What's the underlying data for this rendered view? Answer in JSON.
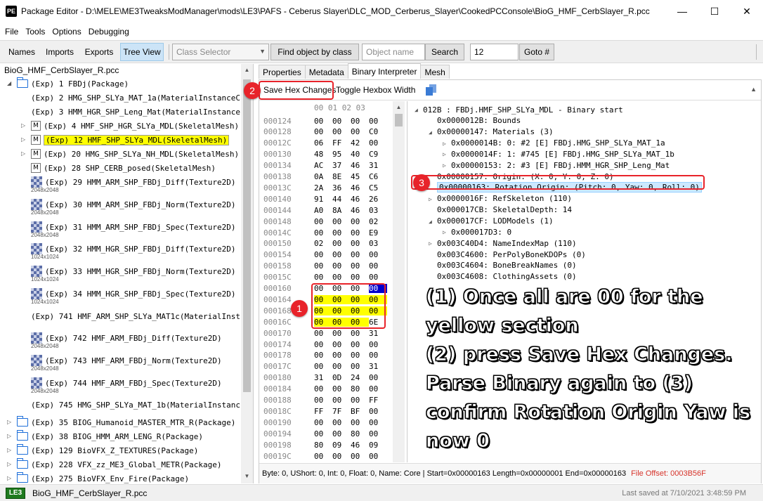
{
  "titlebar": {
    "icon_text": "PE",
    "title": "Package Editor - D:\\MELE\\ME3TweaksModManager\\mods\\LE3\\PAFS - Ceberus Slayer\\DLC_MOD_Cerberus_Slayer\\CookedPCConsole\\BioG_HMF_CerbSlayer_R.pcc",
    "minimize": "—",
    "maximize": "☐",
    "close": "✕"
  },
  "menu": [
    "File",
    "Tools",
    "Options",
    "Debugging"
  ],
  "toolbar": {
    "names": "Names",
    "imports": "Imports",
    "exports": "Exports",
    "tree_view": "Tree View",
    "class_selector": "Class Selector",
    "find_by_class": "Find object by class",
    "object_name_placeholder": "Object name",
    "search": "Search",
    "goto_value": "12",
    "goto": "Goto #"
  },
  "tree": {
    "root": "BioG_HMF_CerbSlayer_R.pcc",
    "rows": [
      {
        "icon": "folder",
        "exp": "down",
        "text": "(Exp) 1 FBDj(Package)"
      },
      {
        "icon": "none",
        "exp": "",
        "text": "(Exp) 2 HMG_SHP_SLYa_MAT_1a(MaterialInstanceC"
      },
      {
        "icon": "none",
        "exp": "",
        "text": "(Exp) 3 HMM_HGR_SHP_Leng_Mat(MaterialInstance("
      },
      {
        "icon": "mesh",
        "exp": "right",
        "text": "(Exp) 4 HMF_SHP_HGR_SLYa_MDL(SkeletalMesh)"
      },
      {
        "icon": "mesh",
        "exp": "right",
        "text": "(Exp) 12 HMF_SHP_SLYa_MDL(SkeletalMesh)",
        "highlight": true
      },
      {
        "icon": "mesh",
        "exp": "right",
        "text": "(Exp) 20 HMG_SHP_SLYa_NH_MDL(SkeletalMesh)"
      },
      {
        "icon": "mesh",
        "exp": "",
        "text": "(Exp) 28 SHP_CERB_posed(SkeletalMesh)"
      },
      {
        "icon": "texture",
        "exp": "",
        "text": "(Exp) 29 HMM_ARM_SHP_FBDj_Diff(Texture2D)",
        "res": "2048x2048"
      },
      {
        "icon": "texture",
        "exp": "",
        "text": "(Exp) 30 HMM_ARM_SHP_FBDj_Norm(Texture2D)",
        "res": "2048x2048"
      },
      {
        "icon": "texture",
        "exp": "",
        "text": "(Exp) 31 HMM_ARM_SHP_FBDj_Spec(Texture2D)",
        "res": "2048x2048"
      },
      {
        "icon": "texture",
        "exp": "",
        "text": "(Exp) 32 HMM_HGR_SHP_FBDj_Diff(Texture2D)",
        "res": "1024x1024"
      },
      {
        "icon": "texture",
        "exp": "",
        "text": "(Exp) 33 HMM_HGR_SHP_FBDj_Norm(Texture2D)",
        "res": "1024x1024"
      },
      {
        "icon": "texture",
        "exp": "",
        "text": "(Exp) 34 HMM_HGR_SHP_FBDj_Spec(Texture2D)",
        "res": "1024x1024"
      },
      {
        "icon": "none",
        "exp": "",
        "text": "(Exp) 741 HMF_ARM_SHP_SLYa_MAT1c(MaterialInst("
      },
      {
        "icon": "texture",
        "exp": "",
        "text": "(Exp) 742 HMF_ARM_FBDj_Diff(Texture2D)",
        "res": "2048x2048"
      },
      {
        "icon": "texture",
        "exp": "",
        "text": "(Exp) 743 HMF_ARM_FBDj_Norm(Texture2D)",
        "res": "2048x2048"
      },
      {
        "icon": "texture",
        "exp": "",
        "text": "(Exp) 744 HMF_ARM_FBDj_Spec(Texture2D)",
        "res": "2048x2048"
      },
      {
        "icon": "none",
        "exp": "",
        "text": "(Exp) 745 HMG_SHP_SLYa_MAT_1b(MaterialInstanc"
      },
      {
        "icon": "folder",
        "exp": "right",
        "text": "(Exp) 35 BIOG_Humanoid_MASTER_MTR_R(Package)"
      },
      {
        "icon": "folder",
        "exp": "right",
        "text": "(Exp) 38 BIOG_HMM_ARM_LENG_R(Package)"
      },
      {
        "icon": "folder",
        "exp": "right",
        "text": "(Exp) 129 BioVFX_Z_TEXTURES(Package)"
      },
      {
        "icon": "folder",
        "exp": "right",
        "text": "(Exp) 228 VFX_zz_ME3_Global_METR(Package)"
      },
      {
        "icon": "folder",
        "exp": "right",
        "text": "(Exp) 275 BioVFX_Env_Fire(Package)"
      }
    ]
  },
  "tabs": [
    "Properties",
    "Metadata",
    "Binary Interpreter",
    "Mesh"
  ],
  "bi_toolbar": {
    "save_hex": "Save Hex Changes",
    "toggle_width": "Toggle Hexbox Width"
  },
  "hex": {
    "header": "00 01 02 03",
    "rows": [
      {
        "addr": "000124",
        "b": [
          "00",
          "00",
          "00",
          "00"
        ]
      },
      {
        "addr": "000128",
        "b": [
          "00",
          "00",
          "00",
          "C0"
        ]
      },
      {
        "addr": "00012C",
        "b": [
          "06",
          "FF",
          "42",
          "00"
        ]
      },
      {
        "addr": "000130",
        "b": [
          "48",
          "95",
          "40",
          "C9"
        ]
      },
      {
        "addr": "000134",
        "b": [
          "AC",
          "37",
          "46",
          "31"
        ]
      },
      {
        "addr": "000138",
        "b": [
          "0A",
          "8E",
          "45",
          "C6"
        ]
      },
      {
        "addr": "00013C",
        "b": [
          "2A",
          "36",
          "46",
          "C5"
        ]
      },
      {
        "addr": "000140",
        "b": [
          "91",
          "44",
          "46",
          "26"
        ]
      },
      {
        "addr": "000144",
        "b": [
          "A0",
          "8A",
          "46",
          "03"
        ]
      },
      {
        "addr": "000148",
        "b": [
          "00",
          "00",
          "00",
          "02"
        ]
      },
      {
        "addr": "00014C",
        "b": [
          "00",
          "00",
          "00",
          "E9"
        ]
      },
      {
        "addr": "000150",
        "b": [
          "02",
          "00",
          "00",
          "03"
        ]
      },
      {
        "addr": "000154",
        "b": [
          "00",
          "00",
          "00",
          "00"
        ]
      },
      {
        "addr": "000158",
        "b": [
          "00",
          "00",
          "00",
          "00"
        ]
      },
      {
        "addr": "00015C",
        "b": [
          "00",
          "00",
          "00",
          "00"
        ]
      },
      {
        "addr": "000160",
        "b": [
          "00",
          "00",
          "00",
          "00"
        ],
        "y": [
          0,
          0,
          0,
          0
        ],
        "sel": 3
      },
      {
        "addr": "000164",
        "b": [
          "00",
          "00",
          "00",
          "00"
        ],
        "y": [
          1,
          1,
          1,
          1
        ]
      },
      {
        "addr": "000168",
        "b": [
          "00",
          "00",
          "00",
          "00"
        ],
        "y": [
          1,
          1,
          1,
          1
        ]
      },
      {
        "addr": "00016C",
        "b": [
          "00",
          "00",
          "00",
          "6E"
        ],
        "y": [
          1,
          1,
          1,
          0
        ]
      },
      {
        "addr": "000170",
        "b": [
          "00",
          "00",
          "00",
          "31"
        ]
      },
      {
        "addr": "000174",
        "b": [
          "00",
          "00",
          "00",
          "00"
        ]
      },
      {
        "addr": "000178",
        "b": [
          "00",
          "00",
          "00",
          "00"
        ]
      },
      {
        "addr": "00017C",
        "b": [
          "00",
          "00",
          "00",
          "31"
        ]
      },
      {
        "addr": "000180",
        "b": [
          "31",
          "0D",
          "24",
          "00"
        ]
      },
      {
        "addr": "000184",
        "b": [
          "00",
          "00",
          "80",
          "00"
        ]
      },
      {
        "addr": "000188",
        "b": [
          "00",
          "00",
          "00",
          "FF"
        ]
      },
      {
        "addr": "00018C",
        "b": [
          "FF",
          "7F",
          "BF",
          "00"
        ]
      },
      {
        "addr": "000190",
        "b": [
          "00",
          "00",
          "00",
          "00"
        ]
      },
      {
        "addr": "000194",
        "b": [
          "00",
          "00",
          "80",
          "00"
        ]
      },
      {
        "addr": "000198",
        "b": [
          "80",
          "09",
          "46",
          "09"
        ]
      },
      {
        "addr": "00019C",
        "b": [
          "00",
          "00",
          "00",
          "00"
        ]
      }
    ]
  },
  "interp": [
    {
      "lvl": 0,
      "arrow": "down",
      "text": "012B : FBDj.HMF_SHP_SLYa_MDL - Binary start"
    },
    {
      "lvl": 1,
      "arrow": "",
      "text": "0x0000012B: Bounds"
    },
    {
      "lvl": 1,
      "arrow": "down",
      "text": "0x00000147: Materials (3)"
    },
    {
      "lvl": 2,
      "arrow": "right",
      "text": "0x0000014B: 0: #2 [E] FBDj.HMG_SHP_SLYa_MAT_1a"
    },
    {
      "lvl": 2,
      "arrow": "right",
      "text": "0x0000014F: 1: #745 [E] FBDj.HMG_SHP_SLYa_MAT_1b"
    },
    {
      "lvl": 2,
      "arrow": "right",
      "text": "0x00000153: 2: #3 [E] FBDj.HMM_HGR_SHP_Leng_Mat"
    },
    {
      "lvl": 1,
      "arrow": "",
      "text": "0x00000157: Origin: (X: 0, Y: 0, Z: 0)"
    },
    {
      "lvl": 1,
      "arrow": "",
      "text": "0x00000163: Rotation Origin: (Pitch: 0, Yaw: 0, Roll: 0)",
      "sel": true
    },
    {
      "lvl": 1,
      "arrow": "right",
      "text": "0x0000016F: RefSkeleton (110)"
    },
    {
      "lvl": 1,
      "arrow": "",
      "text": "0x000017CB: SkeletalDepth: 14"
    },
    {
      "lvl": 1,
      "arrow": "down",
      "text": "0x000017CF: LODModels (1)"
    },
    {
      "lvl": 2,
      "arrow": "right",
      "text": "0x000017D3: 0"
    },
    {
      "lvl": 1,
      "arrow": "right",
      "text": "0x003C40D4: NameIndexMap (110)"
    },
    {
      "lvl": 1,
      "arrow": "",
      "text": "0x003C4600: PerPolyBoneKDOPs (0)"
    },
    {
      "lvl": 1,
      "arrow": "",
      "text": "0x003C4604: BoneBreakNames (0)"
    },
    {
      "lvl": 1,
      "arrow": "",
      "text": "0x003C4608: ClothingAssets (0)"
    }
  ],
  "status": {
    "main": "Byte: 0, UShort: 0, Int: 0, Float: 0, Name: Core | Start=0x00000163 Length=0x00000001 End=0x00000163",
    "file_offset": "File Offset: 0003B56F"
  },
  "bottom": {
    "game": "LE3",
    "file": "BioG_HMF_CerbSlayer_R.pcc",
    "saved": "Last saved at 7/10/2021 3:48:59 PM"
  },
  "callouts": [
    "1",
    "2",
    "3"
  ],
  "overlay": [
    "(1) Once all are 00 for the",
    "yellow section",
    "(2) press Save Hex Changes.",
    "Parse Binary again to (3)",
    "confirm Rotation Origin Yaw is",
    "now 0"
  ],
  "colors": {
    "callout": "#e8232a",
    "highlight": "#ffff00",
    "selection": "#0000cc",
    "status_red": "#d6332a",
    "overlay_text": "#ffffff"
  }
}
